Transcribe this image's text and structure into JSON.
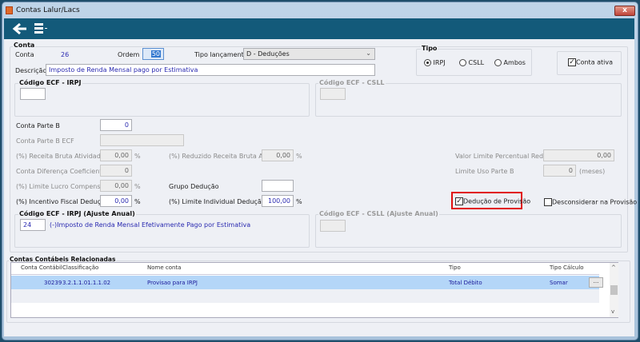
{
  "window": {
    "title": "Contas Lalur/Lacs",
    "close": "x"
  },
  "toolbar": {
    "back": "back",
    "menu": "menu"
  },
  "conta": {
    "group_title": "Conta",
    "conta_label": "Conta",
    "conta_value": "26",
    "ordem_label": "Ordem",
    "ordem_value": "50",
    "tipo_lancamento_label": "Tipo lançamento",
    "tipo_lancamento_value": "D - Deduções",
    "descricao_label": "Descrição",
    "descricao_value": "Imposto de Renda Mensal pago por Estimativa",
    "ecf_irpj_title": "Código ECF - IRPJ",
    "ecf_irpj_value": "",
    "ecf_csll_title": "Código ECF - CSLL",
    "tipo": {
      "title": "Tipo",
      "options": [
        "IRPJ",
        "CSLL",
        "Ambos"
      ],
      "selected": "IRPJ"
    },
    "conta_ativa": {
      "label": "Conta ativa",
      "checked": true
    },
    "conta_parte_b_label": "Conta Parte B",
    "conta_parte_b_value": "0",
    "conta_parte_b_ecf_label": "Conta Parte B ECF",
    "receita_bruta_label": "(%) Receita Bruta Atividade",
    "receita_bruta_value": "0,00",
    "reduzido_label": "(%) Reduzido Receita Bruta Atv",
    "reduzido_value": "0,00",
    "conta_diferenca_label": "Conta Diferença Coeficiente",
    "conta_diferenca_value": "0",
    "limite_lucro_label": "(%) Limite Lucro Compensação",
    "limite_lucro_value": "0,00",
    "grupo_deducao_label": "Grupo Dedução",
    "grupo_deducao_value": "",
    "incentivo_label": "(%) Incentivo Fiscal Dedução",
    "incentivo_value": "0,00",
    "limite_individual_label": "(%) Limite Individual Dedução",
    "limite_individual_value": "100,00",
    "pct": "%",
    "valor_limite_label": "Valor Limite Percentual Reduzido",
    "valor_limite_value": "0,00",
    "limite_uso_label": "Limite Uso Parte B",
    "limite_uso_value": "0",
    "meses": "(meses)",
    "deducao_provisao": {
      "label": "Dedução de Provisão",
      "checked": true
    },
    "desconsiderar": {
      "label": "Desconsiderar na Provisão",
      "checked": false
    },
    "ecf_irpj_anual_title": "Código ECF - IRPJ (Ajuste Anual)",
    "ecf_irpj_anual_value": "24",
    "ecf_irpj_anual_desc": "(-)Imposto de Renda Mensal Efetivamente Pago por Estimativa",
    "ecf_csll_anual_title": "Código ECF - CSLL (Ajuste Anual)"
  },
  "relacionadas": {
    "title": "Contas Contábeis Relacionadas",
    "columns": [
      "Conta Contábil",
      "Classificação",
      "Nome conta",
      "Tipo",
      "Tipo Cálculo"
    ],
    "rows": [
      {
        "conta": "30239",
        "classificacao": "3.2.1.1.01.1.1.02",
        "nome": "Provisao para IRPJ",
        "tipo": "Total Débito",
        "calculo": "Somar",
        "action": "..."
      }
    ]
  }
}
